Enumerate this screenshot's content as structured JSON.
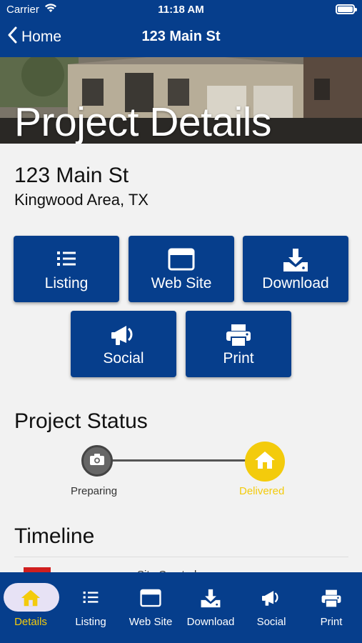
{
  "status_bar": {
    "carrier": "Carrier",
    "time": "11:18 AM"
  },
  "nav": {
    "back_label": "Home",
    "title": "123 Main St"
  },
  "hero": {
    "title": "Project Details"
  },
  "address": {
    "line1": "123 Main St",
    "line2": "Kingwood Area, TX"
  },
  "actions": [
    {
      "label": "Listing",
      "icon": "list-icon"
    },
    {
      "label": "Web Site",
      "icon": "browser-window-icon"
    },
    {
      "label": "Download",
      "icon": "download-icon"
    },
    {
      "label": "Social",
      "icon": "megaphone-icon"
    },
    {
      "label": "Print",
      "icon": "printer-icon"
    }
  ],
  "project_status": {
    "title": "Project Status",
    "steps": [
      {
        "label": "Preparing",
        "icon": "camera-icon",
        "color": "#666666"
      },
      {
        "label": "Delivered",
        "icon": "home-icon",
        "color": "#f3cb0c"
      }
    ]
  },
  "timeline": {
    "title": "Timeline",
    "first_entry": "Site Created"
  },
  "tabs": [
    {
      "label": "Details",
      "icon": "home-icon",
      "active": true
    },
    {
      "label": "Listing",
      "icon": "list-icon"
    },
    {
      "label": "Web Site",
      "icon": "browser-window-icon"
    },
    {
      "label": "Download",
      "icon": "download-icon"
    },
    {
      "label": "Social",
      "icon": "megaphone-icon"
    },
    {
      "label": "Print",
      "icon": "printer-icon"
    }
  ],
  "colors": {
    "brand_blue": "#063e8c",
    "accent_yellow": "#f3cb0c",
    "active_tab_pill": "#e7e2f5",
    "timeline_marker": "#d01f1f"
  }
}
